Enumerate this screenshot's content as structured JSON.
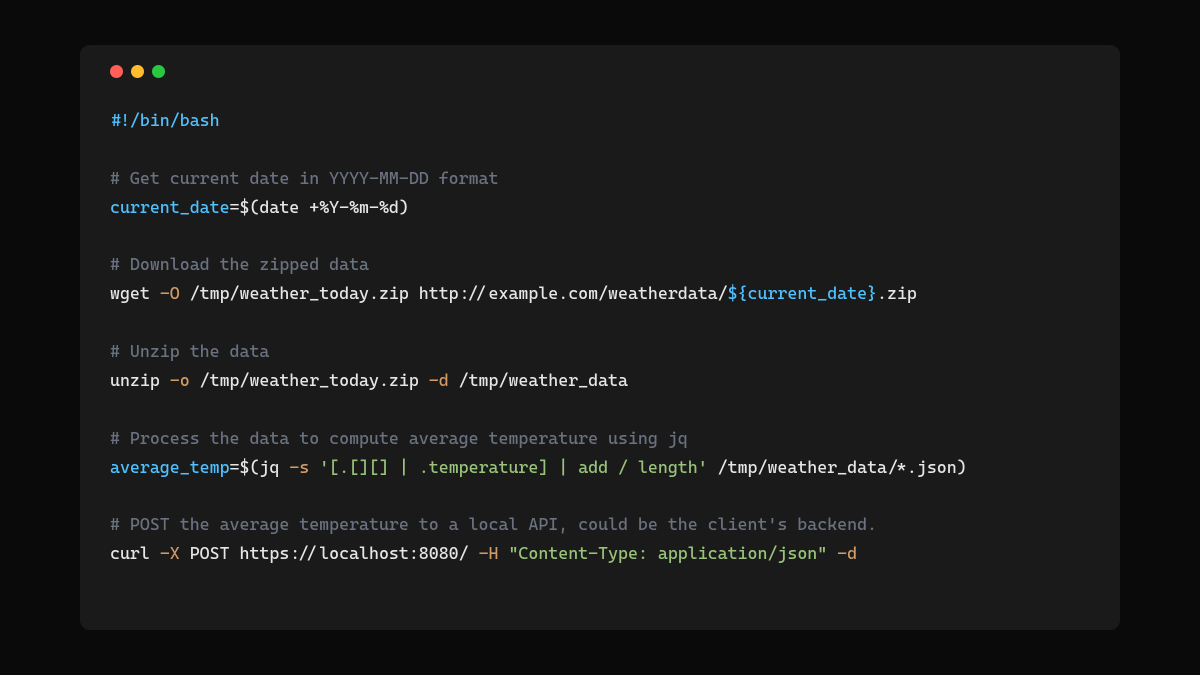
{
  "code": {
    "shebang": "#!/bin/bash",
    "comment1": "# Get current date in YYYY-MM-DD format",
    "line2_var": "current_date",
    "line2_eq": "=",
    "line2_sub_open": "$(",
    "line2_cmd": "date +%Y-%m-%d",
    "line2_sub_close": ")",
    "comment2": "# Download the zipped data",
    "line4_cmd": "wget ",
    "line4_flag": "-O",
    "line4_path": " /tmp/weather_today.zip http://example.com/weatherdata/",
    "line4_varref": "${current_date}",
    "line4_ext": ".zip",
    "comment3": "# Unzip the data",
    "line6_cmd": "unzip ",
    "line6_flag1": "-o",
    "line6_path1": " /tmp/weather_today.zip ",
    "line6_flag2": "-d",
    "line6_path2": " /tmp/weather_data",
    "comment4": "# Process the data to compute average temperature using jq",
    "line8_var": "average_temp",
    "line8_eq": "=",
    "line8_sub_open": "$(",
    "line8_cmd": "jq ",
    "line8_flag": "-s",
    "line8_sp": " ",
    "line8_str": "'[.[][] | .temperature] | add / length'",
    "line8_path": " /tmp/weather_data/*.json",
    "line8_sub_close": ")",
    "comment5": "# POST the average temperature to a local API, could be the client's backend.",
    "line10_cmd": "curl ",
    "line10_flag1": "-X",
    "line10_method": " POST https://localhost:8080/ ",
    "line10_flag2": "-H",
    "line10_sp2": " ",
    "line10_header": "\"Content-Type: application/json\"",
    "line10_sp3": " ",
    "line10_flag3": "-d"
  }
}
